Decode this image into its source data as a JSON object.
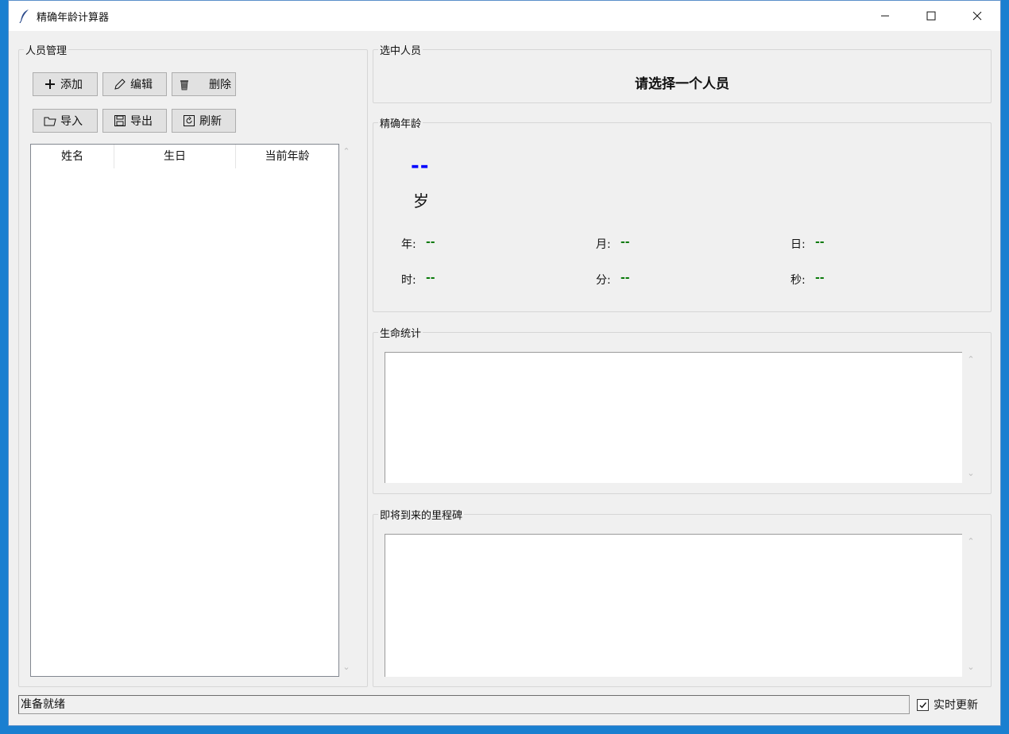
{
  "window": {
    "title": "精确年龄计算器"
  },
  "people_panel": {
    "legend": "人员管理",
    "toolbar": {
      "add_label": "添加",
      "edit_label": "编辑",
      "delete_label": "删除",
      "import_label": "导入",
      "export_label": "导出",
      "refresh_label": "刷新"
    },
    "table": {
      "columns": [
        "姓名",
        "生日",
        "当前年龄"
      ],
      "rows": []
    }
  },
  "selected_panel": {
    "legend": "选中人员",
    "placeholder": "请选择一个人员"
  },
  "age_panel": {
    "legend": "精确年龄",
    "big_value": "--",
    "unit": "岁",
    "fields": [
      {
        "label": "年:",
        "value": "--"
      },
      {
        "label": "月:",
        "value": "--"
      },
      {
        "label": "日:",
        "value": "--"
      },
      {
        "label": "时:",
        "value": "--"
      },
      {
        "label": "分:",
        "value": "--"
      },
      {
        "label": "秒:",
        "value": "--"
      }
    ]
  },
  "stats_panel": {
    "legend": "生命统计",
    "content": ""
  },
  "milestones_panel": {
    "legend": "即将到来的里程碑",
    "content": ""
  },
  "status": {
    "text": "准备就绪",
    "realtime_label": "实时更新",
    "realtime_checked": true
  },
  "colors": {
    "big_value": "#0000ff",
    "field_value": "#0a7a0a"
  }
}
